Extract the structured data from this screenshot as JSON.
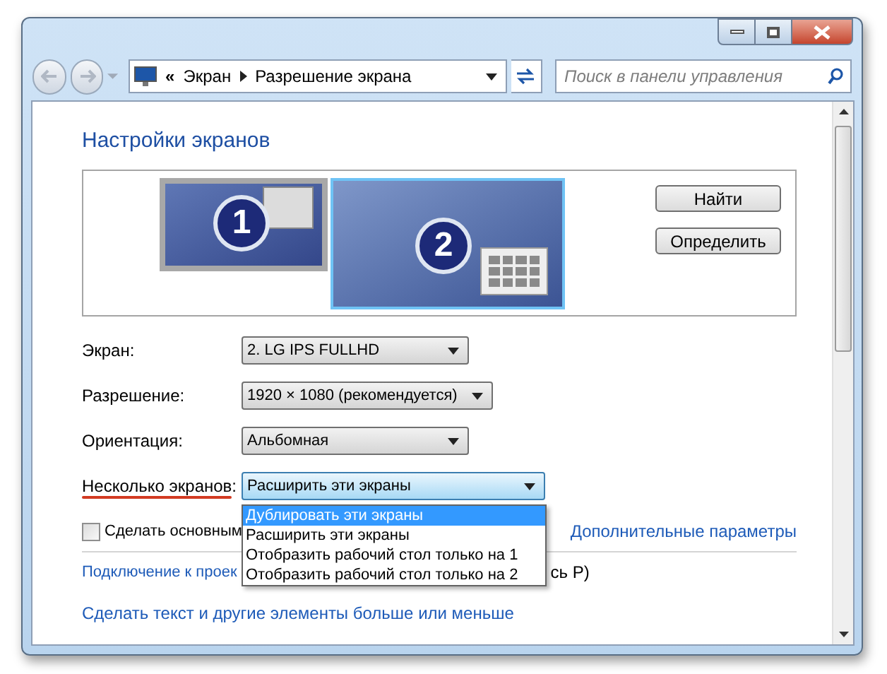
{
  "nav": {
    "prefix": "«",
    "breadcrumb": [
      "Экран",
      "Разрешение экрана"
    ],
    "search": {
      "placeholder": "Поиск в панели управления"
    }
  },
  "heading": "Настройки экранов",
  "monitors": [
    {
      "label": "1",
      "selected": false
    },
    {
      "label": "2",
      "selected": true
    }
  ],
  "side_buttons": [
    "Найти",
    "Определить"
  ],
  "fields": [
    {
      "label": "Экран:",
      "value": "2. LG IPS FULLHD",
      "focused": false,
      "underlined": false
    },
    {
      "label": "Разрешение:",
      "value": "1920 × 1080 (рекомендуется)",
      "focused": false,
      "underlined": false
    },
    {
      "label": "Ориентация:",
      "value": "Альбомная",
      "focused": false,
      "underlined": false
    },
    {
      "label": "Несколько экранов:",
      "value": "Расширить эти экраны",
      "focused": true,
      "underlined": true
    }
  ],
  "dropdown": {
    "options": [
      {
        "label": "Дублировать эти экраны",
        "selected": true
      },
      {
        "label": "Расширить эти экраны",
        "selected": false
      },
      {
        "label": "Отобразить рабочий стол только на 1",
        "selected": false
      },
      {
        "label": "Отобразить рабочий стол только на 2",
        "selected": false
      }
    ]
  },
  "primary_checkbox": {
    "label": "Сделать основным",
    "checked": false
  },
  "advanced_link": "Дополнительные параметры",
  "projector_link": {
    "text": "Подключение к проек",
    "tail": "сь P)"
  },
  "text_size_link": "Сделать текст и другие элементы больше или меньше"
}
